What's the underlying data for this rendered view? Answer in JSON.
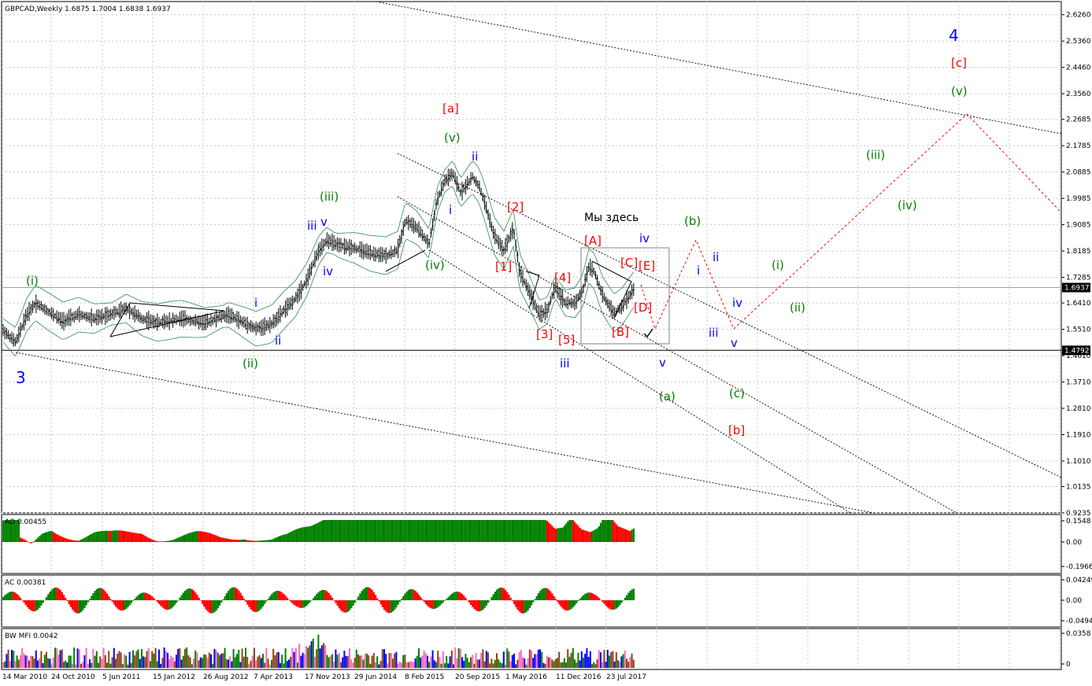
{
  "header": {
    "symbol_line": "GBPCAD,Weekly  1.6875 1.7004 1.6838 1.6937"
  },
  "annotation_text": "Мы здесь",
  "price_axis": {
    "ticks": [
      "2.6260",
      "2.5360",
      "2.4460",
      "2.3560",
      "2.2685",
      "2.1785",
      "2.0885",
      "1.9985",
      "1.9085",
      "1.8185",
      "1.7285",
      "1.6410",
      "1.5510",
      "1.4610",
      "1.3710",
      "1.2810",
      "1.1910",
      "1.1010",
      "1.0135",
      "0.9235"
    ],
    "current_price_label": "1.6937",
    "support_label": "1.4792"
  },
  "time_axis": {
    "labels": [
      "14 Mar 2010",
      "24 Oct 2010",
      "5 Jun 2011",
      "15 Jan 2012",
      "26 Aug 2012",
      "7 Apr 2013",
      "17 Nov 2013",
      "29 Jun 2014",
      "8 Feb 2015",
      "20 Sep 2015",
      "1 May 2016",
      "11 Dec 2016",
      "23 Jul 2017"
    ]
  },
  "indicators": {
    "ao": {
      "title": "AO 0.00455",
      "ticks": [
        "0.15481",
        "0.00",
        "-0.19667"
      ]
    },
    "ac": {
      "title": "AC 0.00381",
      "ticks": [
        "0.04249",
        "0.00",
        "-0.04946"
      ]
    },
    "mfi": {
      "title": "BW MFI 0.0042",
      "ticks": [
        "0.0358",
        "0"
      ]
    }
  },
  "wave_labels": [
    {
      "text": "3",
      "color": "#0000ff",
      "size": "big"
    },
    {
      "text": "4",
      "color": "#0000ff",
      "size": "big"
    },
    {
      "text": "[c]",
      "color": "#ff0000"
    },
    {
      "text": "(v)",
      "color": "#008000"
    },
    {
      "text": "[a]",
      "color": "#ff0000"
    },
    {
      "text": "(v)",
      "color": "#008000"
    },
    {
      "text": "ii",
      "color": "#0000ff"
    },
    {
      "text": "(iii)",
      "color": "#008000"
    },
    {
      "text": "iii",
      "color": "#0000ff"
    },
    {
      "text": "v",
      "color": "#0000ff"
    },
    {
      "text": "iv",
      "color": "#0000ff"
    },
    {
      "text": "(i)",
      "color": "#008000"
    },
    {
      "text": "i",
      "color": "#0000ff"
    },
    {
      "text": "ii",
      "color": "#0000ff"
    },
    {
      "text": "(ii)",
      "color": "#008000"
    },
    {
      "text": "i",
      "color": "#0000ff"
    },
    {
      "text": "(iv)",
      "color": "#008000"
    },
    {
      "text": "[2]",
      "color": "#ff0000"
    },
    {
      "text": "[1]",
      "color": "#ff0000"
    },
    {
      "text": "[4]",
      "color": "#ff0000"
    },
    {
      "text": "[3]",
      "color": "#ff0000"
    },
    {
      "text": "[5]",
      "color": "#ff0000"
    },
    {
      "text": "iii",
      "color": "#0000ff"
    },
    {
      "text": "[A]",
      "color": "#ff0000"
    },
    {
      "text": "[C]",
      "color": "#ff0000"
    },
    {
      "text": "[E]",
      "color": "#ff0000"
    },
    {
      "text": "[D]",
      "color": "#ff0000"
    },
    {
      "text": "[B]",
      "color": "#ff0000"
    },
    {
      "text": "iv",
      "color": "#0000ff"
    },
    {
      "text": "v",
      "color": "#0000ff"
    },
    {
      "text": "(a)",
      "color": "#008000"
    },
    {
      "text": "(b)",
      "color": "#008000"
    },
    {
      "text": "i",
      "color": "#0000ff"
    },
    {
      "text": "ii",
      "color": "#0000ff"
    },
    {
      "text": "iii",
      "color": "#0000ff"
    },
    {
      "text": "iv",
      "color": "#0000ff"
    },
    {
      "text": "v",
      "color": "#0000ff"
    },
    {
      "text": "(c)",
      "color": "#008000"
    },
    {
      "text": "[b]",
      "color": "#ff0000"
    },
    {
      "text": "(i)",
      "color": "#008000"
    },
    {
      "text": "(ii)",
      "color": "#008000"
    },
    {
      "text": "(iii)",
      "color": "#008000"
    },
    {
      "text": "(iv)",
      "color": "#008000"
    }
  ],
  "chart_data": {
    "type": "line",
    "title": "GBPCAD,Weekly",
    "ohlc_last": {
      "open": 1.6875,
      "high": 1.7004,
      "low": 1.6838,
      "close": 1.6937
    },
    "ylim": [
      0.9235,
      2.671
    ],
    "grid": true,
    "series": [
      {
        "name": "GBPCAD",
        "x": [
          "14 Mar 2010",
          "24 Oct 2010",
          "5 Jun 2011",
          "15 Jan 2012",
          "26 Aug 2012",
          "7 Apr 2013",
          "17 Nov 2013",
          "29 Jun 2014",
          "8 Feb 2015",
          "20 Sep 2015",
          "1 May 2016",
          "11 Dec 2016",
          "23 Jul 2017"
        ],
        "values": [
          1.52,
          1.61,
          1.6,
          1.57,
          1.55,
          1.56,
          1.8,
          1.8,
          1.88,
          2.05,
          1.63,
          1.62,
          1.68
        ]
      }
    ],
    "levels": [
      1.6937,
      1.4792
    ],
    "colors": {
      "bull": "#008000",
      "bear": "#ff0000",
      "projection": "#ff0000",
      "grid": "#c0c0c0"
    }
  }
}
